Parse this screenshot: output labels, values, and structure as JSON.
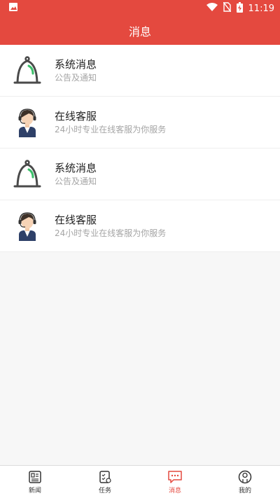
{
  "status_bar": {
    "time": "11:19",
    "icons": [
      "image-icon",
      "wifi-icon",
      "no-sim-icon",
      "battery-charging-icon"
    ]
  },
  "header": {
    "title": "消息"
  },
  "messages": [
    {
      "title": "系统消息",
      "subtitle": "公告及通知",
      "icon": "bell-icon"
    },
    {
      "title": "在线客服",
      "subtitle": "24小时专业在线客服为你服务",
      "icon": "customer-service-avatar-icon"
    },
    {
      "title": "系统消息",
      "subtitle": "公告及通知",
      "icon": "bell-icon"
    },
    {
      "title": "在线客服",
      "subtitle": "24小时专业在线客服为你服务",
      "icon": "customer-service-avatar-icon"
    }
  ],
  "tabs": [
    {
      "label": "新闻",
      "icon": "news-icon",
      "active": false
    },
    {
      "label": "任务",
      "icon": "task-icon",
      "active": false
    },
    {
      "label": "消息",
      "icon": "message-icon",
      "active": true
    },
    {
      "label": "我的",
      "icon": "profile-icon",
      "active": false
    }
  ],
  "colors": {
    "accent": "#e4493f",
    "bell_green": "#3bbf6a"
  }
}
